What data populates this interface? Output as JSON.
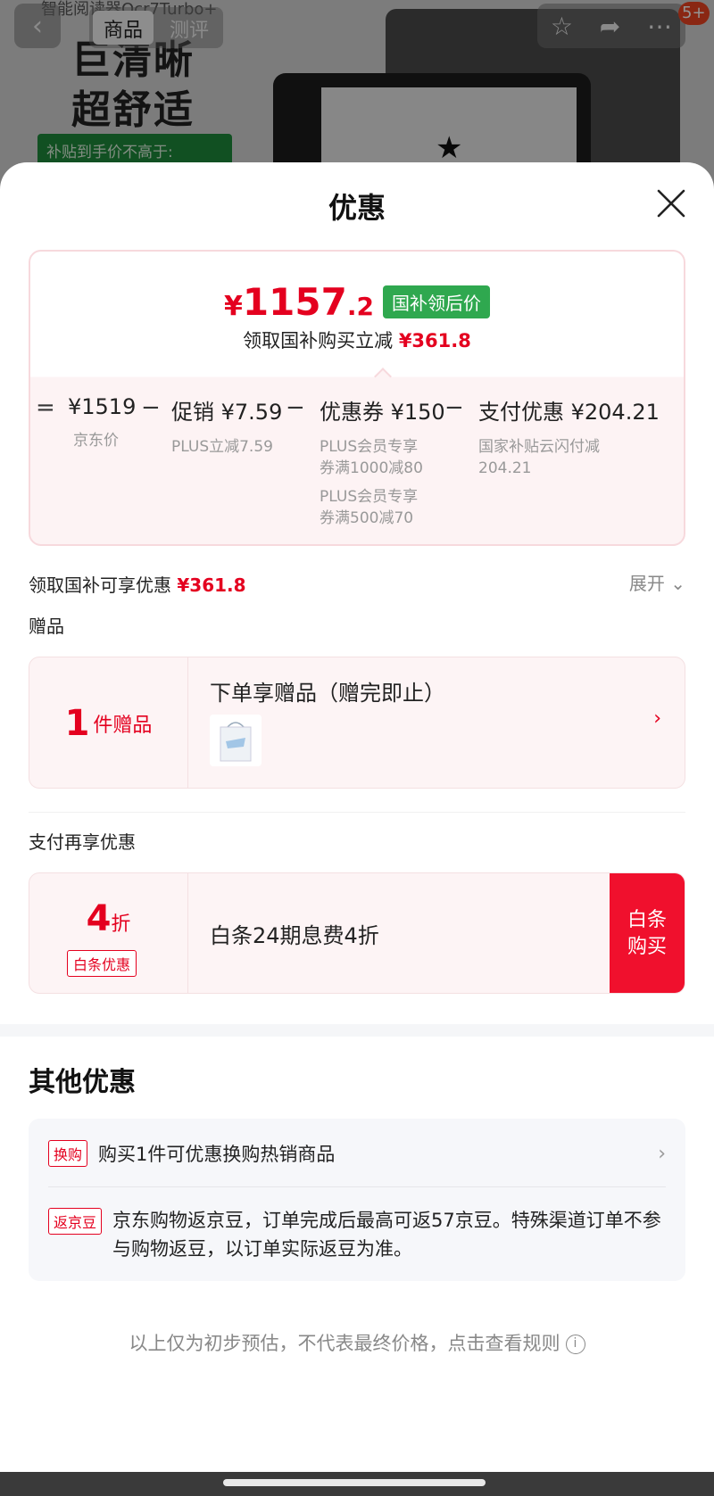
{
  "background": {
    "subtitle": "智能阅读器Ocr7Turbo+",
    "tabs": [
      "商品",
      "测评"
    ],
    "headline_line1": "巨清晰",
    "headline_line2": "超舒适",
    "promo_banner": "补贴到手价不高于:",
    "badge": "5+"
  },
  "sheet": {
    "title": "优惠"
  },
  "price": {
    "yen": "¥",
    "integer": "1157",
    "decimal": ".2",
    "tag": "国补领后价",
    "sub_label": "领取国补购买立减",
    "sub_amount": "¥361.8"
  },
  "formula": {
    "ops": [
      "=",
      "−",
      "−",
      "−"
    ],
    "items": [
      {
        "amount": "¥1519",
        "desc": [
          "京东价"
        ]
      },
      {
        "amount": "促销 ¥7.59",
        "desc": [
          "PLUS立减7.59"
        ]
      },
      {
        "amount": "优惠券 ¥150",
        "desc": [
          "PLUS会员专享\n券满1000减80",
          "PLUS会员专享\n券满500减70"
        ]
      },
      {
        "amount": "支付优惠 ¥204.21",
        "desc": [
          "国家补贴云闪付减\n204.21"
        ]
      }
    ]
  },
  "summary": {
    "label": "领取国补可享优惠",
    "amount": "¥361.8",
    "expand": "展开"
  },
  "gift": {
    "section_label": "赠品",
    "count": "1",
    "unit": "件赠品",
    "title": "下单享赠品（赠完即止）"
  },
  "pay": {
    "section_label": "支付再享优惠",
    "discount_num": "4",
    "discount_unit": "折",
    "tag": "白条优惠",
    "text": "白条24期息费4折",
    "button_line1": "白条",
    "button_line2": "购买"
  },
  "other": {
    "title": "其他优惠",
    "rows": [
      {
        "tag": "换购",
        "text": "购买1件可优惠换购热销商品"
      },
      {
        "tag": "返京豆",
        "text": "京东购物返京豆，订单完成后最高可返57京豆。特殊渠道订单不参与购物返豆，以订单实际返豆为准。"
      }
    ]
  },
  "footnote": "以上仅为初步预估，不代表最终价格，点击查看规则",
  "colors": {
    "accent_red": "#e4001f",
    "button_red": "#f0102d",
    "tag_green": "#2fa84f"
  }
}
